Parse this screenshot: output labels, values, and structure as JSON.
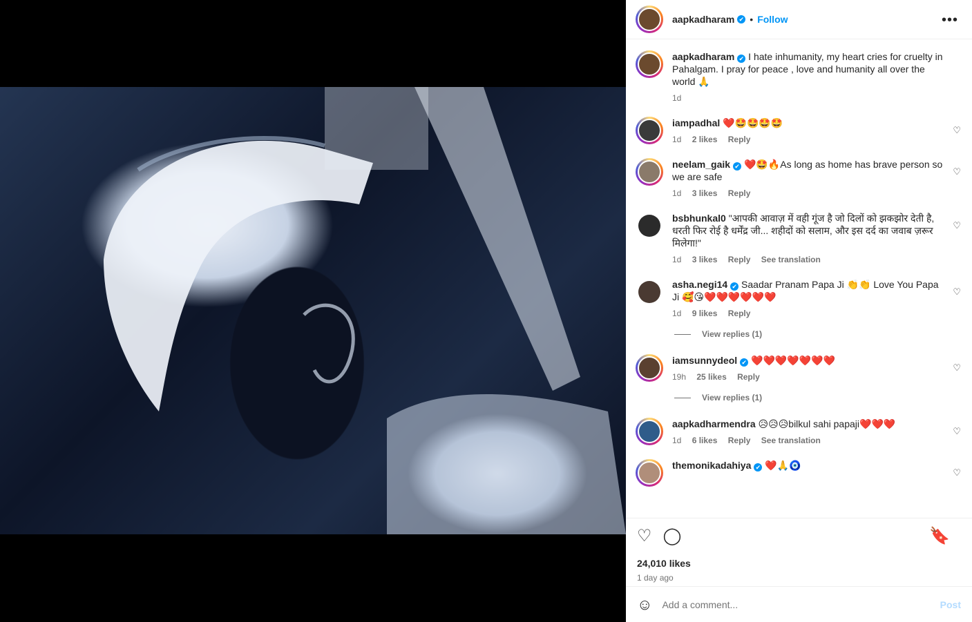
{
  "header": {
    "username": "aapkadharam",
    "verified_mark": "✔",
    "follow_label": "Follow",
    "separator": "•",
    "more_label": "•••"
  },
  "caption": {
    "username": "aapkadharam",
    "text": "I hate inhumanity, my heart cries for cruelty in Pahalgam. I pray for peace , love and humanity all over the world 🙏",
    "time": "1d"
  },
  "comments": [
    {
      "username": "iampadhal",
      "verified": false,
      "text": "❤️🤩🤩🤩🤩",
      "time": "1d",
      "likes": "2 likes",
      "reply": "Reply"
    },
    {
      "username": "neelam_gaik",
      "verified": true,
      "text": "❤️🤩🔥As long as home has brave person so we are safe",
      "time": "1d",
      "likes": "3 likes",
      "reply": "Reply"
    },
    {
      "username": "bsbhunkal0",
      "verified": false,
      "text": "\"आपकी आवाज़ में वही गूंज है जो दिलों को झकझोर देती है, धरती फिर रोई है धर्मेंद्र जी... शहीदों को सलाम, और इस दर्द का जवाब ज़रूर मिलेगा!\"",
      "time": "1d",
      "likes": "3 likes",
      "reply": "Reply",
      "translation": "See translation"
    },
    {
      "username": "asha.negi14",
      "verified": true,
      "text": "Saadar Pranam Papa Ji 👏👏 Love You Papa Ji 🥰😘❤️❤️❤️❤️❤️❤️",
      "time": "1d",
      "likes": "9 likes",
      "reply": "Reply",
      "view_replies": "View replies (1)"
    },
    {
      "username": "iamsunnydeol",
      "verified": true,
      "text": "❤️❤️❤️❤️❤️❤️❤️",
      "time": "19h",
      "likes": "25 likes",
      "reply": "Reply",
      "view_replies": "View replies (1)"
    },
    {
      "username": "aapkadharmendra",
      "verified": false,
      "text": "😥😥😥bilkul sahi papaji❤️❤️❤️",
      "time": "1d",
      "likes": "6 likes",
      "reply": "Reply",
      "translation": "See translation"
    },
    {
      "username": "themonikadahiya",
      "verified": true,
      "text": "❤️🙏🧿",
      "time": "",
      "likes": "",
      "reply": ""
    }
  ],
  "actions": {
    "like_icon": "♡",
    "comment_icon": "◯",
    "save_icon": "🔖"
  },
  "likes": "24,010 likes",
  "posted": "1 day ago",
  "add_comment": {
    "placeholder": "Add a comment...",
    "post_label": "Post",
    "emoji_icon": "☺"
  },
  "icons": {
    "comment_like": "♡"
  },
  "colors": {
    "accent": "#0095f6",
    "muted": "#737373",
    "post_disabled": "#b3dbff"
  }
}
